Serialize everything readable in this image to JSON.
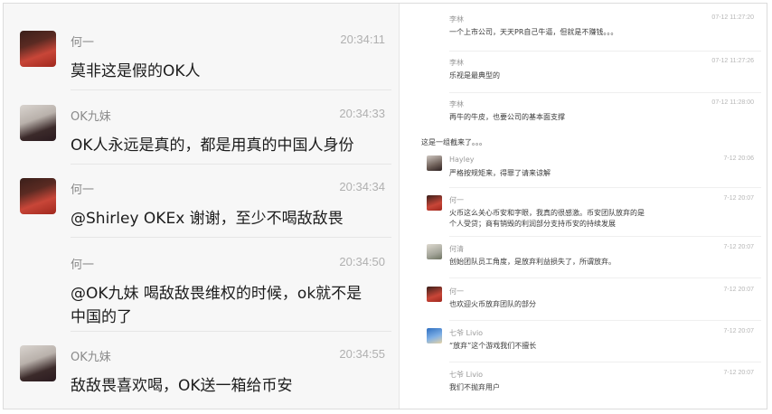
{
  "left_chat": [
    {
      "name": "何一",
      "time": "20:34:11",
      "text": "莫非这是假的OK人",
      "avatar": "avatar-he"
    },
    {
      "name": "OK九妹",
      "time": "20:34:33",
      "text": "OK人永远是真的，都是用真的中国人身份",
      "avatar": "avatar-ok"
    },
    {
      "name": "何一",
      "time": "20:34:34",
      "text": "@Shirley OKEx 谢谢，至少不喝敌敌畏",
      "avatar": "avatar-he"
    },
    {
      "name": "何一",
      "time": "20:34:50",
      "text_line1": "@OK九妹 喝敌敌畏维权的时候，ok就不是",
      "text_line2": "中国的了"
    },
    {
      "name": "OK九妹",
      "time": "20:34:55",
      "text": "敌敌畏喜欢喝，OK送一箱给币安",
      "avatar": "avatar-ok"
    }
  ],
  "right_chat": {
    "top_messages": [
      {
        "name": "李林",
        "time": "07-12 11:27:20",
        "text": "一个上市公司，天天PR自己牛逼，但就是不赚钱。。。"
      },
      {
        "name": "李林",
        "time": "07-12 11:27:26",
        "text": "乐视是最典型的"
      },
      {
        "name": "李林",
        "time": "07-12 11:28:00",
        "text": "再牛的牛皮，也要公司的基本面支撑"
      }
    ],
    "note": "这是一组截来了。。。",
    "messages": [
      {
        "name": "Hayley",
        "time": "7-12 20:06",
        "text": "严格按规矩来，得罪了请来谅解",
        "avatar": "hay"
      },
      {
        "name": "何一",
        "time": "7-12 20:07",
        "text_line1": "火币这么关心币安和字眼，我真的很感激。币安团队放弃的是",
        "text_line2": "个人受贷；商有销毁的利润部分支持币安的持续发展",
        "avatar": "red"
      },
      {
        "name": "何清",
        "time": "7-12 20:07",
        "text": "创始团队员工角度，是放弃利益损失了，所谓放弃。",
        "avatar": "he2"
      },
      {
        "name": "何一",
        "time": "7-12 20:07",
        "text": "也欢迎火币放弃团队的部分",
        "avatar": "red"
      },
      {
        "name": "七爷 Livio",
        "time": "7-12 20:07",
        "text": "“放弃”这个游戏我们不擅长",
        "avatar": "blue"
      },
      {
        "name": "七爷 Livio",
        "time": "7-12 20:07",
        "text": "我们不抛弃用户"
      }
    ]
  }
}
